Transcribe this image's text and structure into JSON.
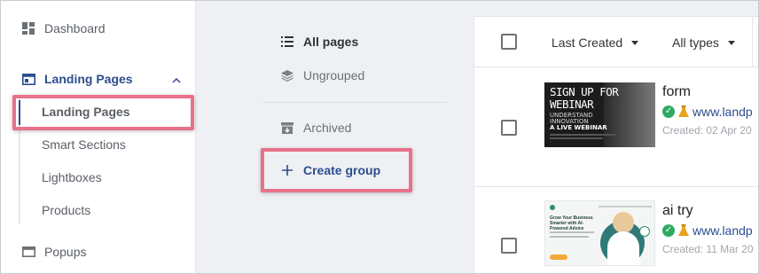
{
  "sidebar": {
    "dashboard_label": "Dashboard",
    "landing_pages_label": "Landing Pages",
    "sub_items": [
      "Landing Pages",
      "Smart Sections",
      "Lightboxes",
      "Products"
    ],
    "popups_label": "Popups"
  },
  "groups": {
    "all_pages": "All pages",
    "ungrouped": "Ungrouped",
    "archived": "Archived",
    "create_group": "Create group"
  },
  "filters": {
    "sort": "Last Created",
    "type": "All types"
  },
  "rows": [
    {
      "name": "form",
      "url": "www.landp",
      "created": "Created: 02 Apr 20",
      "thumb": {
        "line1": "SIGN UP FOR",
        "line2": "WEBINAR",
        "line3": "UNDERSTAND",
        "line4": "INNOVATION",
        "line5": "A LIVE WEBINAR"
      }
    },
    {
      "name": "ai try",
      "url": "www.landp",
      "created": "Created: 11 Mar 20",
      "thumb": {
        "headline": "Grow Your Business Smarter with AI-Powered Advice"
      }
    }
  ],
  "colors": {
    "accent": "#2c4d8f",
    "highlight": "#e8728a",
    "success": "#2eaa62"
  }
}
